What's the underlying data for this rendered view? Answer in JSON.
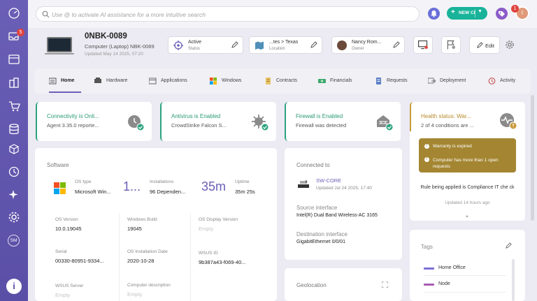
{
  "search": {
    "placeholder": "Use @ to activate AI assistance for a more intuitive search"
  },
  "topbar": {
    "new_ci_label": "NEW CI",
    "notification_count": "1",
    "avatar_initial": "I"
  },
  "sidebar": {
    "badge_count": "5",
    "sm_label": "SM",
    "logo_letter": "i"
  },
  "asset": {
    "name": "0NBK-0089",
    "type": "Computer (Laptop) NBK-0089",
    "updated": "Updated May 14 2025, 07:20"
  },
  "header_cards": {
    "status": {
      "value": "Active",
      "label": "Status"
    },
    "location": {
      "value": "...tes > Texas",
      "label": "Location"
    },
    "owner": {
      "value": "Nancy Rom...",
      "label": "Owner"
    }
  },
  "actions": {
    "edit_label": "Edit"
  },
  "tabs": [
    {
      "label": "Home"
    },
    {
      "label": "Hardware"
    },
    {
      "label": "Applications"
    },
    {
      "label": "Windows"
    },
    {
      "label": "Contracts"
    },
    {
      "label": "Financials"
    },
    {
      "label": "Requests"
    },
    {
      "label": "Deployment"
    },
    {
      "label": "Activity"
    }
  ],
  "status_cards": [
    {
      "title": "Connectivity is Onli...",
      "subtitle": "Agent 3.35.0 reporte..."
    },
    {
      "title": "Antivirus is Enabled",
      "subtitle": "CrowdStrike Falcon S..."
    },
    {
      "title": "Firewall is Enabled",
      "subtitle": "Firewall was detected"
    },
    {
      "title": "Health status: War...",
      "subtitle": "2 of 4 conditions are ..."
    }
  ],
  "software": {
    "title": "Software",
    "os_type_label": "OS type",
    "os_type_value": "Microsoft Win...",
    "installations_big": "1...",
    "installations_label": "Installations",
    "installations_value": "96 Dependen...",
    "uptime_big": "35m",
    "uptime_label": "Uptime",
    "uptime_value": "35m 25s",
    "fields": [
      {
        "label": "OS Version",
        "value": "10.0.19045"
      },
      {
        "label": "Windows Build",
        "value": "19045"
      },
      {
        "label": "OS Display Version",
        "value": "Empty"
      },
      {
        "label": "Serial",
        "value": "00330-80951-9334..."
      },
      {
        "label": "OS Installation Date",
        "value": "2020-10-28"
      },
      {
        "label": "WSUS ID",
        "value": "9b387a43-f069-40..."
      },
      {
        "label": "WSUS Server",
        "value": "Empty"
      },
      {
        "label": "Computer description",
        "value": "Empty"
      }
    ]
  },
  "connected": {
    "title": "Connected to",
    "device_name": "SW-CORE",
    "device_updated": "Updated Jul 24 2025, 17:40",
    "source_label": "Source interface",
    "source_value": "Intel(R) Dual Band Wireless-AC 3165",
    "dest_label": "Destination interface",
    "dest_value": "GigabitEthernet 0/0/01"
  },
  "geolocation": {
    "title": "Geolocation"
  },
  "health_detail": {
    "warnings": [
      "Warranty is expired",
      "Computer has more than 1 open requests"
    ],
    "rule": "Rule being applied is Compliance IT che ck",
    "updated": "Updated 14 hours ago"
  },
  "tags": {
    "title": "Tags",
    "items": [
      {
        "name": "Home Office",
        "color": "#7b6fd6"
      },
      {
        "name": "Node",
        "color": "#a85bb0"
      }
    ]
  },
  "colors": {
    "accent": "#6a5fb6",
    "green": "#2ba37f",
    "warning": "#a48632",
    "new_ci": "#19b39a"
  }
}
